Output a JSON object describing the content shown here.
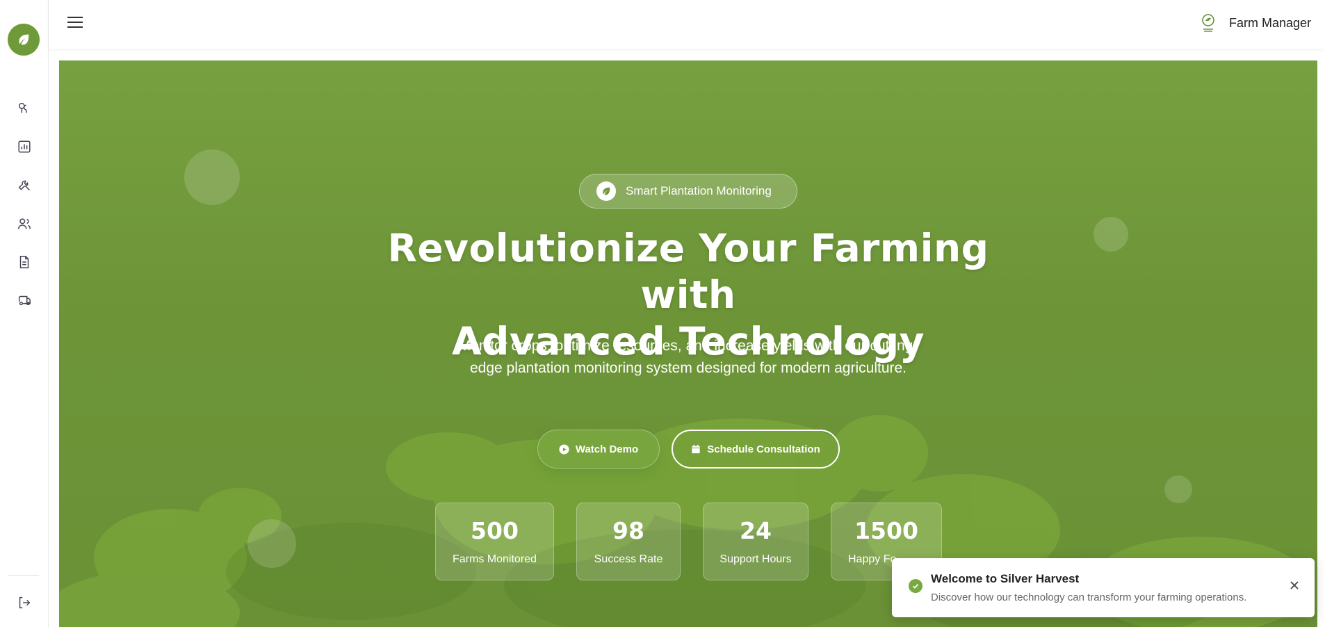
{
  "app": {
    "logo_icon": "leaf-icon",
    "brand_color": "#6f9a3a"
  },
  "sidebar": {
    "items": [
      {
        "name": "plantation",
        "icon": "trees-icon"
      },
      {
        "name": "analytics",
        "icon": "bar-chart-icon"
      },
      {
        "name": "tools",
        "icon": "wrench-screwdriver-icon"
      },
      {
        "name": "users",
        "icon": "users-icon"
      },
      {
        "name": "reports",
        "icon": "document-icon"
      },
      {
        "name": "logistics",
        "icon": "truck-icon"
      }
    ],
    "logout_icon": "logout-icon"
  },
  "header": {
    "menu_icon": "hamburger-icon",
    "user_name": "Farm Manager",
    "avatar_icon": "silver-harvest-logo"
  },
  "hero": {
    "badge": "Smart Plantation Monitoring",
    "headline_line1": "Revolutionize Your Farming with",
    "headline_line2": "Advanced Technology",
    "subheadline": "Monitor crops, optimize resources, and increase yields with our cutting-edge plantation monitoring system designed for modern agriculture.",
    "buttons": {
      "demo": "Watch Demo",
      "consult": "Schedule Consultation"
    },
    "stats": [
      {
        "value": "500",
        "label": "Farms Monitored"
      },
      {
        "value": "98",
        "label": "Success Rate"
      },
      {
        "value": "24",
        "label": "Support Hours"
      },
      {
        "value": "1500",
        "label": "Happy Fo"
      }
    ],
    "colors": {
      "background": "#6f9a3a",
      "button": "#79a53f"
    }
  },
  "toast": {
    "title": "Welcome to Silver Harvest",
    "message": "Discover how our technology can transform your farming operations.",
    "icon": "check-circle-icon",
    "close_icon": "close-icon",
    "accent": "#7aa843"
  }
}
